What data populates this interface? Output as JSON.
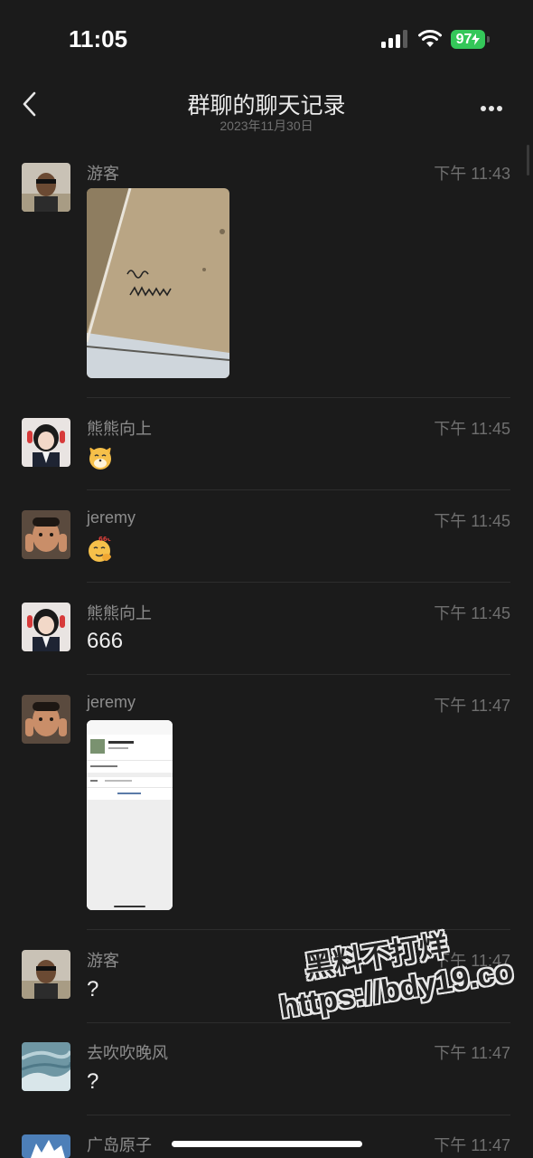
{
  "status_bar": {
    "time": "11:05",
    "battery": "97"
  },
  "header": {
    "title": "群聊的聊天记录",
    "date": "2023年11月30日"
  },
  "messages": [
    {
      "sender": "游客",
      "time": "下午 11:43",
      "type": "image"
    },
    {
      "sender": "熊熊向上",
      "time": "下午 11:45",
      "type": "emoji",
      "emoji_icon": "cat-face-emoji"
    },
    {
      "sender": "jeremy",
      "time": "下午 11:45",
      "type": "emoji",
      "emoji_icon": "666-face-emoji"
    },
    {
      "sender": "熊熊向上",
      "time": "下午 11:45",
      "type": "text",
      "text": "666"
    },
    {
      "sender": "jeremy",
      "time": "下午 11:47",
      "type": "image"
    },
    {
      "sender": "游客",
      "time": "下午 11:47",
      "type": "text",
      "text": "?"
    },
    {
      "sender": "去吹吹晚风",
      "time": "下午 11:47",
      "type": "text",
      "text": "?"
    },
    {
      "sender": "广岛原子",
      "time": "下午 11:47",
      "type": "text"
    }
  ],
  "watermark": {
    "line1": "黑料不打烊",
    "line2": "https://bdy19.co"
  },
  "colors": {
    "background": "#1b1b1b",
    "battery": "#34c759",
    "text": "#ededed",
    "secondary": "#8d8d8d"
  }
}
